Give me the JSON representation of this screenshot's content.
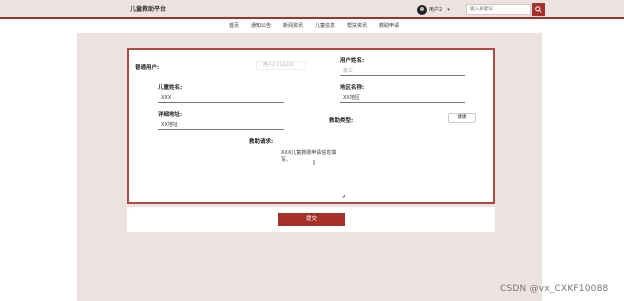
{
  "header": {
    "brand": "儿童救助平台",
    "user_name": "用户2",
    "search_placeholder": "输入关键词"
  },
  "nav": [
    "首页",
    "通知公告",
    "新闻资讯",
    "儿童信息",
    "帮扶资讯",
    "救助申请"
  ],
  "form": {
    "account_label": "普通用户:",
    "account_value": "用户2-112233",
    "username_label": "用户姓名:",
    "username_value": "张三",
    "child_name_label": "儿童姓名:",
    "child_name_value": "XXX",
    "region_label": "地区名称:",
    "region_value": "XX地区",
    "address_label": "详细地址:",
    "address_value": "XX地址",
    "type_label": "救助类型:",
    "type_value": "健康",
    "request_label": "救助请求:",
    "request_value": "XXX儿童救助申请信息填写。"
  },
  "submit_label": "提交",
  "watermark": "CSDN @vx_CXKF10088",
  "colors": {
    "accent": "#a8302b",
    "background": "#ece3e1"
  }
}
